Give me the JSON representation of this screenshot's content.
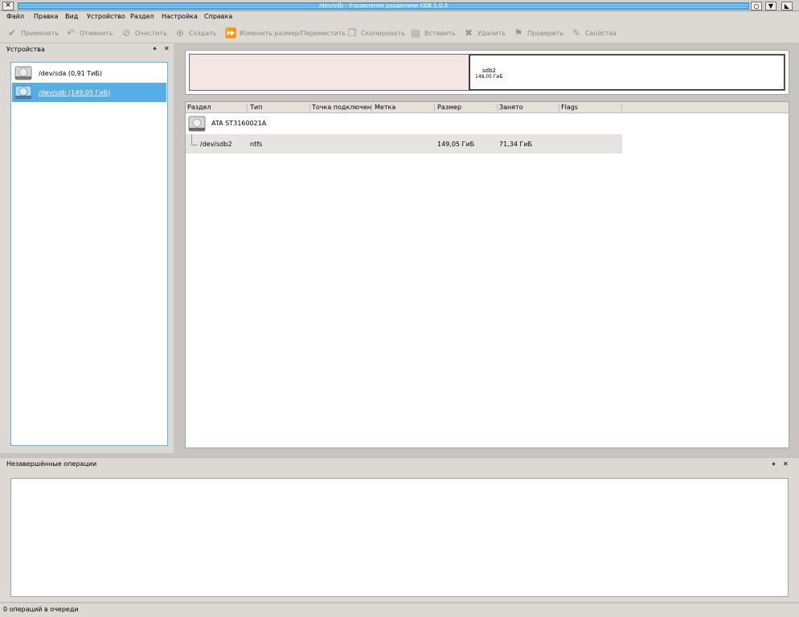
{
  "window": {
    "title": "/dev/sdb - Управление разделами KDE 1.0.3",
    "close_glyph": "✕",
    "btn_glyphs": [
      "○",
      "▼",
      "◣"
    ]
  },
  "menu": [
    "Файл",
    "Правка",
    "Вид",
    "Устройство",
    "Раздел",
    "Настройка",
    "Справка"
  ],
  "toolbar": {
    "apply": "Применить",
    "undo": "Отменить",
    "clear": "Очистить",
    "create": "Создать",
    "resize": "Изменить размер/Переместить",
    "copy": "Скопировать",
    "paste": "Вставить",
    "delete": "Удалить",
    "check": "Проверить",
    "properties": "Свойства"
  },
  "devices_dock": {
    "title": "Устройства",
    "float_glyph": "⋄",
    "close_glyph": "✕",
    "items": [
      {
        "label": "/dev/sda (0,91 ТиБ)"
      },
      {
        "label": "/dev/sdb (149,05 ГиБ)"
      }
    ]
  },
  "partition_map": {
    "name": "sdb2",
    "size": "149,05 ГиБ"
  },
  "tree": {
    "columns": [
      "Раздел",
      "Тип",
      "Точка подключения",
      "Метка",
      "Размер",
      "Занято",
      "Flags"
    ],
    "disk": "ATA ST3160021A",
    "partition": {
      "name": "/dev/sdb2",
      "type": "ntfs",
      "size": "149,05 ГиБ",
      "used": "71,34 ГиБ"
    }
  },
  "ops_dock": {
    "title": "Незавершённые операции",
    "float_glyph": "⋄",
    "close_glyph": "✕"
  },
  "status": "0 операций в очереди"
}
